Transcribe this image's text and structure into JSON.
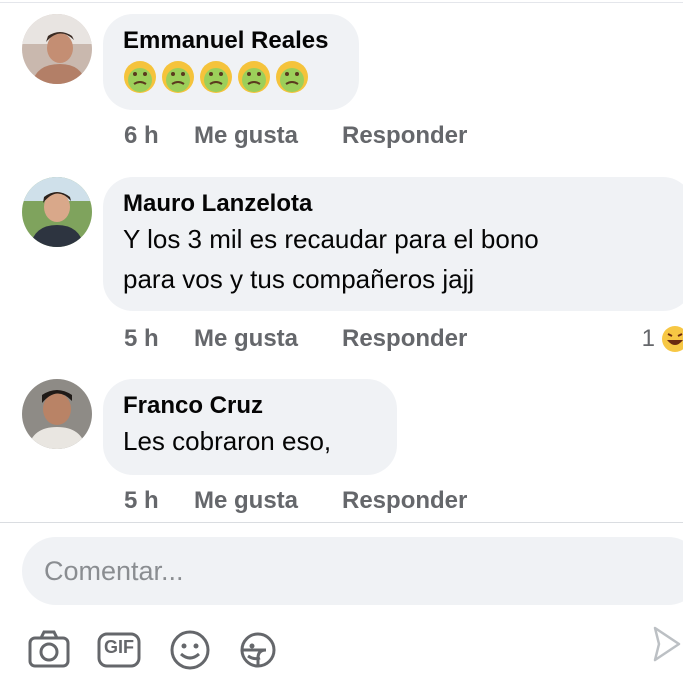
{
  "comments": [
    {
      "author": "Emmanuel Reales",
      "reactions_emoji": [
        "nauseated-face",
        "nauseated-face",
        "nauseated-face",
        "nauseated-face",
        "nauseated-face"
      ],
      "time": "6 h",
      "like_label": "Me gusta",
      "reply_label": "Responder"
    },
    {
      "author": "Mauro Lanzelota",
      "text_lines": [
        "Y los 3 mil es recaudar para el bono",
        "para vos y tus compañeros jajj"
      ],
      "time": "5 h",
      "like_label": "Me gusta",
      "reply_label": "Responder",
      "reaction_count": "1",
      "reaction_icon": "laughing-emoji-icon"
    },
    {
      "author": "Franco Cruz",
      "text_lines": [
        "Les cobraron eso,"
      ],
      "time": "5 h",
      "like_label": "Me gusta",
      "reply_label": "Responder"
    }
  ],
  "composer": {
    "placeholder": "Comentar..."
  },
  "toolbar": {
    "camera_icon": "camera-icon",
    "gif_label": "GIF",
    "emoji_icon": "smiley-icon",
    "sticker_icon": "sticker-icon",
    "send_icon": "send-icon"
  },
  "colors": {
    "bubble": "#f0f2f5",
    "secondary_text": "#65676b",
    "primary_text": "#050505"
  }
}
